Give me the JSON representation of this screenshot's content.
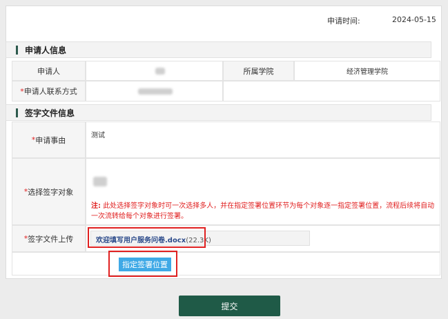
{
  "header": {
    "apply_time_label": "申请时间:",
    "apply_time_value": "2024-05-15"
  },
  "applicant_section": {
    "title": "申请人信息",
    "applicant_label": "申请人",
    "college_label": "所属学院",
    "college_value": "经济管理学院",
    "contact_required_mark": "*",
    "contact_label": "申请人联系方式"
  },
  "document_section": {
    "title": "签字文件信息",
    "reason_required_mark": "*",
    "reason_label": "申请事由",
    "reason_value": "测试",
    "signer_required_mark": "*",
    "signer_label": "选择签字对象",
    "note_prefix": "注:",
    "note_text": "此处选择签字对象时可一次选择多人，并在指定签署位置环节为每个对象逐一指定签署位置，流程后续将自动一次流转给每个对象进行签署。",
    "upload_required_mark": "*",
    "upload_label": "签字文件上传",
    "file_name": "欢迎填写用户服务问卷.docx",
    "file_size": "(22.3K)"
  },
  "buttons": {
    "sign_position": "指定签署位置",
    "submit": "提交"
  }
}
